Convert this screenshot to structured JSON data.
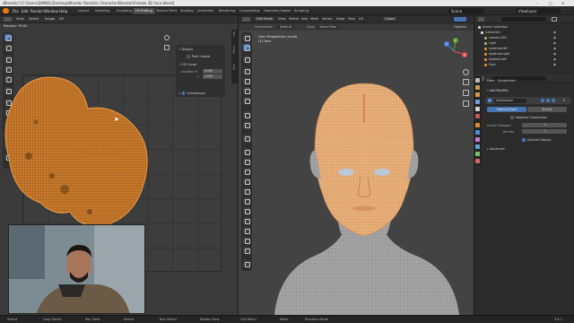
{
  "window": {
    "title": "[Blender] [C:\\Users\\DANIEL\\Desktop\\Blender Realistic Character\\Blender\\Female 3D face.blend]",
    "controls": [
      "–",
      "□",
      "✕"
    ]
  },
  "menu": {
    "items": [
      "File",
      "Edit",
      "Render",
      "Window",
      "Help"
    ],
    "tabs": [
      "Layout",
      "Modeling",
      "Sculpting",
      "UV Editing",
      "Texture Paint",
      "Shading",
      "Animation",
      "Rendering",
      "Compositing",
      "Geometry Nodes",
      "Scripting"
    ],
    "active_tab": "UV Editing",
    "scene_label": "Scene",
    "view_layer_label": "ViewLayer"
  },
  "uv_editor": {
    "header_items": [
      "Rotation",
      "UV Sync",
      "View",
      "Select",
      "Image",
      "UV"
    ],
    "rotation_value": "Rotation: 90.83",
    "npanel": {
      "display_title": "Display",
      "pixel_coords_label": "Pixel Coords",
      "cursor_title": "2D Cursor",
      "location_label": "Location X",
      "location_x": "0.000",
      "location_y_label": "Y",
      "location_y": "0.000",
      "annotations_label": "Annotations"
    },
    "side_tabs": [
      "Tool",
      "Image",
      "View"
    ]
  },
  "viewport": {
    "header_items": [
      "Edit Mode",
      "View",
      "Select",
      "Add",
      "Mesh",
      "Vertex",
      "Edge",
      "Face",
      "UV"
    ],
    "global_label": "Global",
    "orientation_label": "Orientation",
    "orientation_value": "Default",
    "drag_label": "Drag",
    "drag_value": "Select Box",
    "options_label": "Options",
    "overlay_title": "User Perspective (Local)",
    "overlay_subtitle": "(1) Face",
    "axes": {
      "x": "X",
      "y": "Y",
      "z": "Z"
    }
  },
  "outliner": {
    "title": "Scene Collection",
    "rows": [
      {
        "label": "Collection",
        "color": "#d8d8d8"
      },
      {
        "label": "camera.001",
        "color": "#8fb97a"
      },
      {
        "label": "Light",
        "color": "#8fb97a"
      },
      {
        "label": "eyebrow.left",
        "color": "#e08a2e"
      },
      {
        "label": "eyebrow.right",
        "color": "#e08a2e"
      },
      {
        "label": "eyelash.left",
        "color": "#e08a2e"
      },
      {
        "label": "Face",
        "color": "#e08a2e"
      }
    ]
  },
  "properties": {
    "breadcrumb_obj": "Face",
    "breadcrumb_mod": "Subdivision",
    "add_modifier_label": "Add Modifier",
    "modifier_name": "Subdivision",
    "catmull_label": "Catmull-Clark",
    "simple_label": "Simple",
    "adaptive_label": "Adaptive Subdivision",
    "levels_viewport_label": "Levels Viewport",
    "levels_viewport_value": "2",
    "render_label": "Render",
    "render_value": "2",
    "optimal_display_label": "Optimal Display",
    "advanced_label": "Advanced"
  },
  "status": {
    "items": [
      "Select",
      "Loop Select",
      "Pan View",
      "Select",
      "Box Select",
      "Rotate View",
      "Call Menu",
      "Move",
      "Previous Mode"
    ],
    "version": "3.4.1"
  },
  "colors": {
    "accent": "#4772b3",
    "uv_orange": "#d0832f",
    "head_skin": "#e8b07a",
    "body_gray": "#9a9a9a"
  }
}
